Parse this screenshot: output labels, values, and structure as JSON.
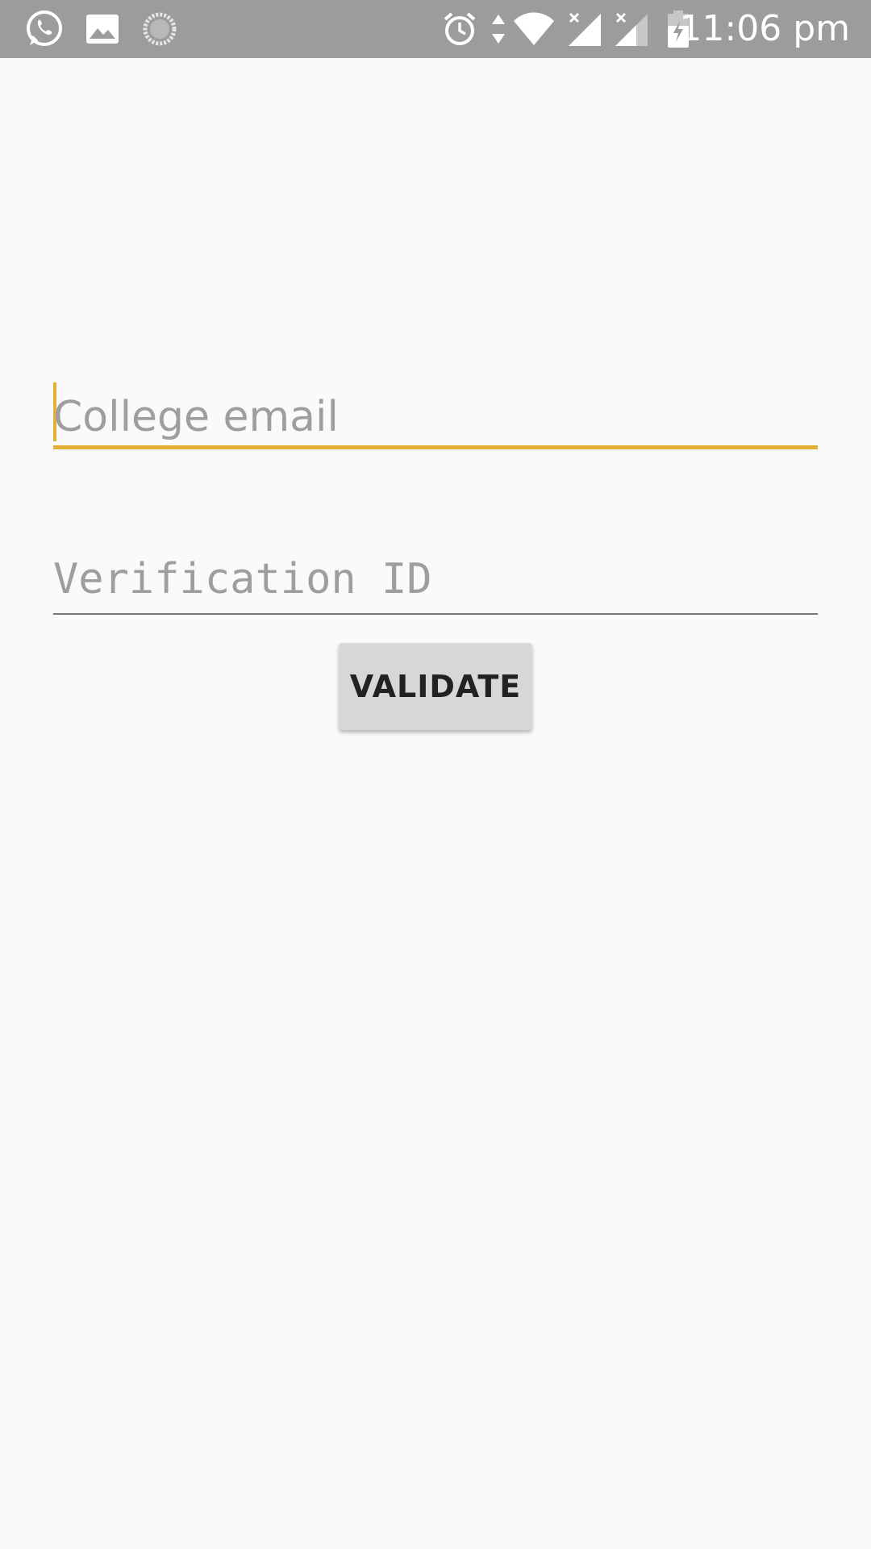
{
  "status_bar": {
    "time": "11:06 pm",
    "left_icons": [
      "whatsapp-icon",
      "gallery-icon",
      "loading-icon"
    ],
    "right_icons": [
      "alarm-icon",
      "data-arrows-icon",
      "wifi-icon",
      "signal-sim1-icon",
      "signal-sim2-icon",
      "battery-charging-icon"
    ],
    "background_color": "#9b9d9a"
  },
  "form": {
    "email": {
      "placeholder": "College email",
      "value": "",
      "focused": true,
      "accent_color": "#e3b135"
    },
    "verification_id": {
      "placeholder": "Verification ID",
      "value": ""
    },
    "validate_button": {
      "label": "VALIDATE"
    }
  },
  "colors": {
    "background": "#fafafa",
    "accent": "#e3b135",
    "button_bg": "#d6d7d7"
  }
}
